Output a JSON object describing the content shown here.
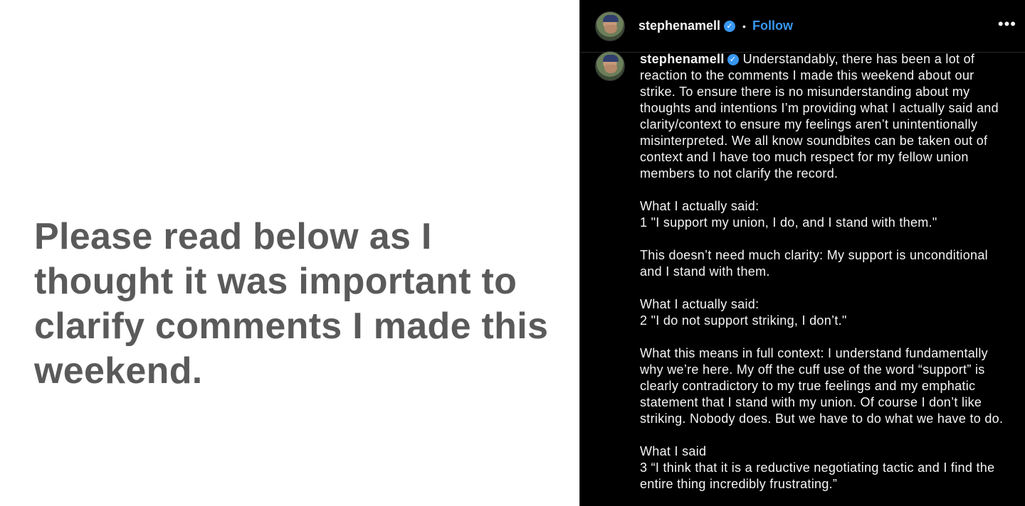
{
  "image": {
    "text": "Please read below as I thought it was important to clarify comments I made this weekend."
  },
  "header": {
    "username": "stephenamell",
    "separator": "•",
    "follow_label": "Follow",
    "more_icon": "ellipsis-icon",
    "verified_icon": "verified-badge-icon"
  },
  "caption": {
    "username": "stephenamell",
    "paragraphs": [
      "Understandably, there has been a lot of reaction to the comments I made this weekend about our strike. To ensure there is no misunderstanding about my thoughts and intentions I’m providing what I actually said and clarity/context to ensure my feelings aren’t unintentionally misinterpreted. We all know soundbites can be taken out of context and I have too much respect for my fellow union members to not clarify the record.",
      "What I actually said:\n1 \"I support my union, I do, and I stand with them.\"",
      "This doesn’t need much clarity: My support is unconditional and I stand with them.",
      "What I actually said:\n2 \"I do not support striking, I don’t.\"",
      "What this means in full context: I understand fundamentally why we’re here. My off the cuff use of the word “support” is clearly contradictory to my true feelings and my emphatic statement that I stand with my union. Of course I don’t like striking. Nobody does. But we have to do what we have to do.",
      "What I said\n3 “I think that it is a reductive negotiating tactic and I find the entire thing incredibly frustrating.”"
    ]
  },
  "colors": {
    "background": "#000000",
    "link": "#3897f0",
    "image_text": "#5a5a5a"
  }
}
